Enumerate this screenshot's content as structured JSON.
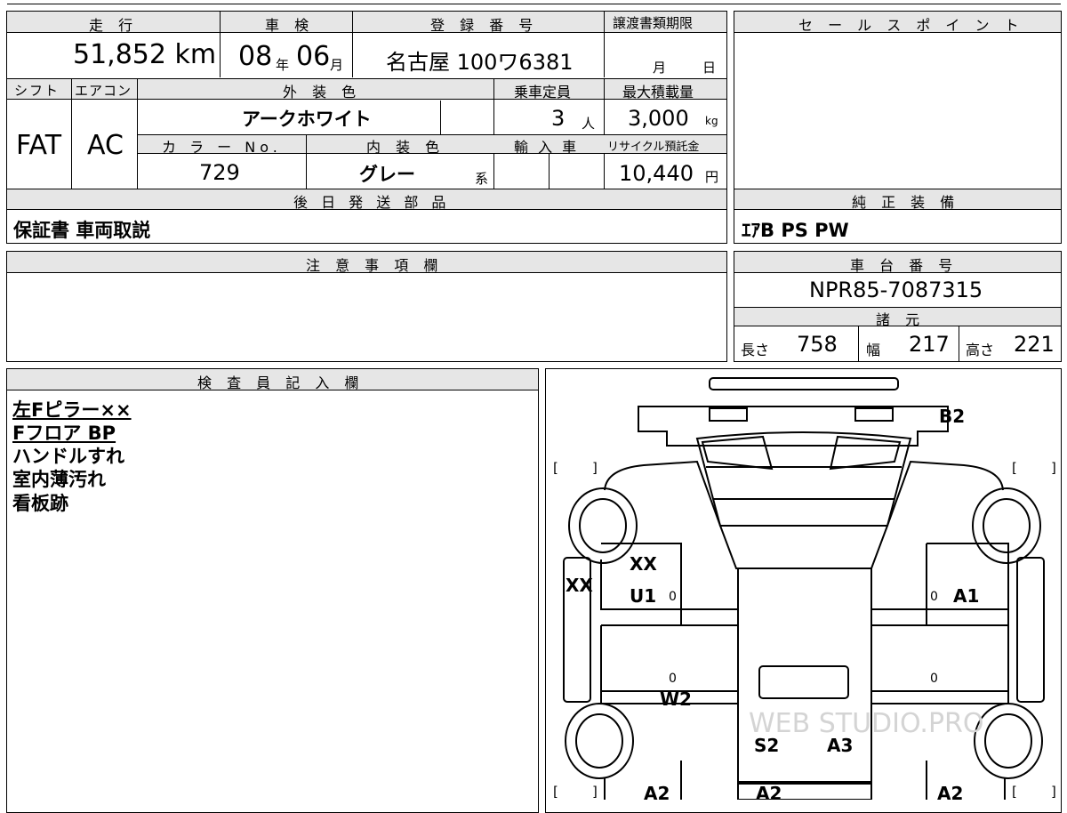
{
  "summary": {
    "mileage_header": "走 行",
    "mileage_value": "51,852 km",
    "inspection_header": "車 検",
    "inspection_year": "08",
    "year_unit": "年",
    "inspection_month": "06",
    "month_unit": "月",
    "reg_header": "登 録 番 号",
    "reg_value": "名古屋 100ワ6381",
    "transfer_header": "譲渡書類期限",
    "transfer_month_unit": "月",
    "transfer_day_unit": "日",
    "shift_header": "シフト",
    "shift_value": "FAT",
    "ac_header": "エアコン",
    "ac_value": "AC",
    "exterior_header": "外 装 色",
    "exterior_value": "アークホワイト",
    "capacity_header": "乗車定員",
    "capacity_value": "3",
    "capacity_unit": "人",
    "load_header": "最大積載量",
    "load_value": "3,000",
    "load_unit": "kg",
    "color_no_header": "カ ラ ー No.",
    "color_no_value": "729",
    "interior_header": "内 装 色",
    "interior_value": "グレー",
    "interior_suffix": "系",
    "import_header": "輸 入 車",
    "recycle_header": "リサイクル預託金",
    "recycle_value": "10,440",
    "recycle_unit": "円",
    "later_header": "後 日 発 送 部 品",
    "later_value": "保証書 車両取説"
  },
  "sales": {
    "header": "セ ー ル ス ポ イ ン ト",
    "equip_header": "純 正 装 備",
    "equip_value": "ｴｱB PS PW"
  },
  "notes": {
    "header": "注 意 事 項 欄"
  },
  "chassis": {
    "header": "車 台 番 号",
    "value": "NPR85-7087315",
    "spec_header": "諸 元",
    "length_label": "長さ",
    "length_value": "758",
    "width_label": "幅",
    "width_value": "217",
    "height_label": "高さ",
    "height_value": "221"
  },
  "inspector": {
    "header": "検 査 員 記 入 欄",
    "lines": [
      "左Fピラー××",
      "Fフロア BP",
      "ハンドルすれ",
      "室内薄汚れ",
      "看板跡"
    ]
  },
  "diagram": {
    "marks": {
      "b2": "B2",
      "xx_top": "XX",
      "xx_left": "XX",
      "u1": "U1",
      "a1": "A1",
      "w2": "W2",
      "s2": "S2",
      "a3": "A3",
      "a2_left": "A2",
      "a2_right": "A2",
      "a2_mid": "A2",
      "zero": "0"
    },
    "watermark": "WEB STUDIO.PRO"
  }
}
